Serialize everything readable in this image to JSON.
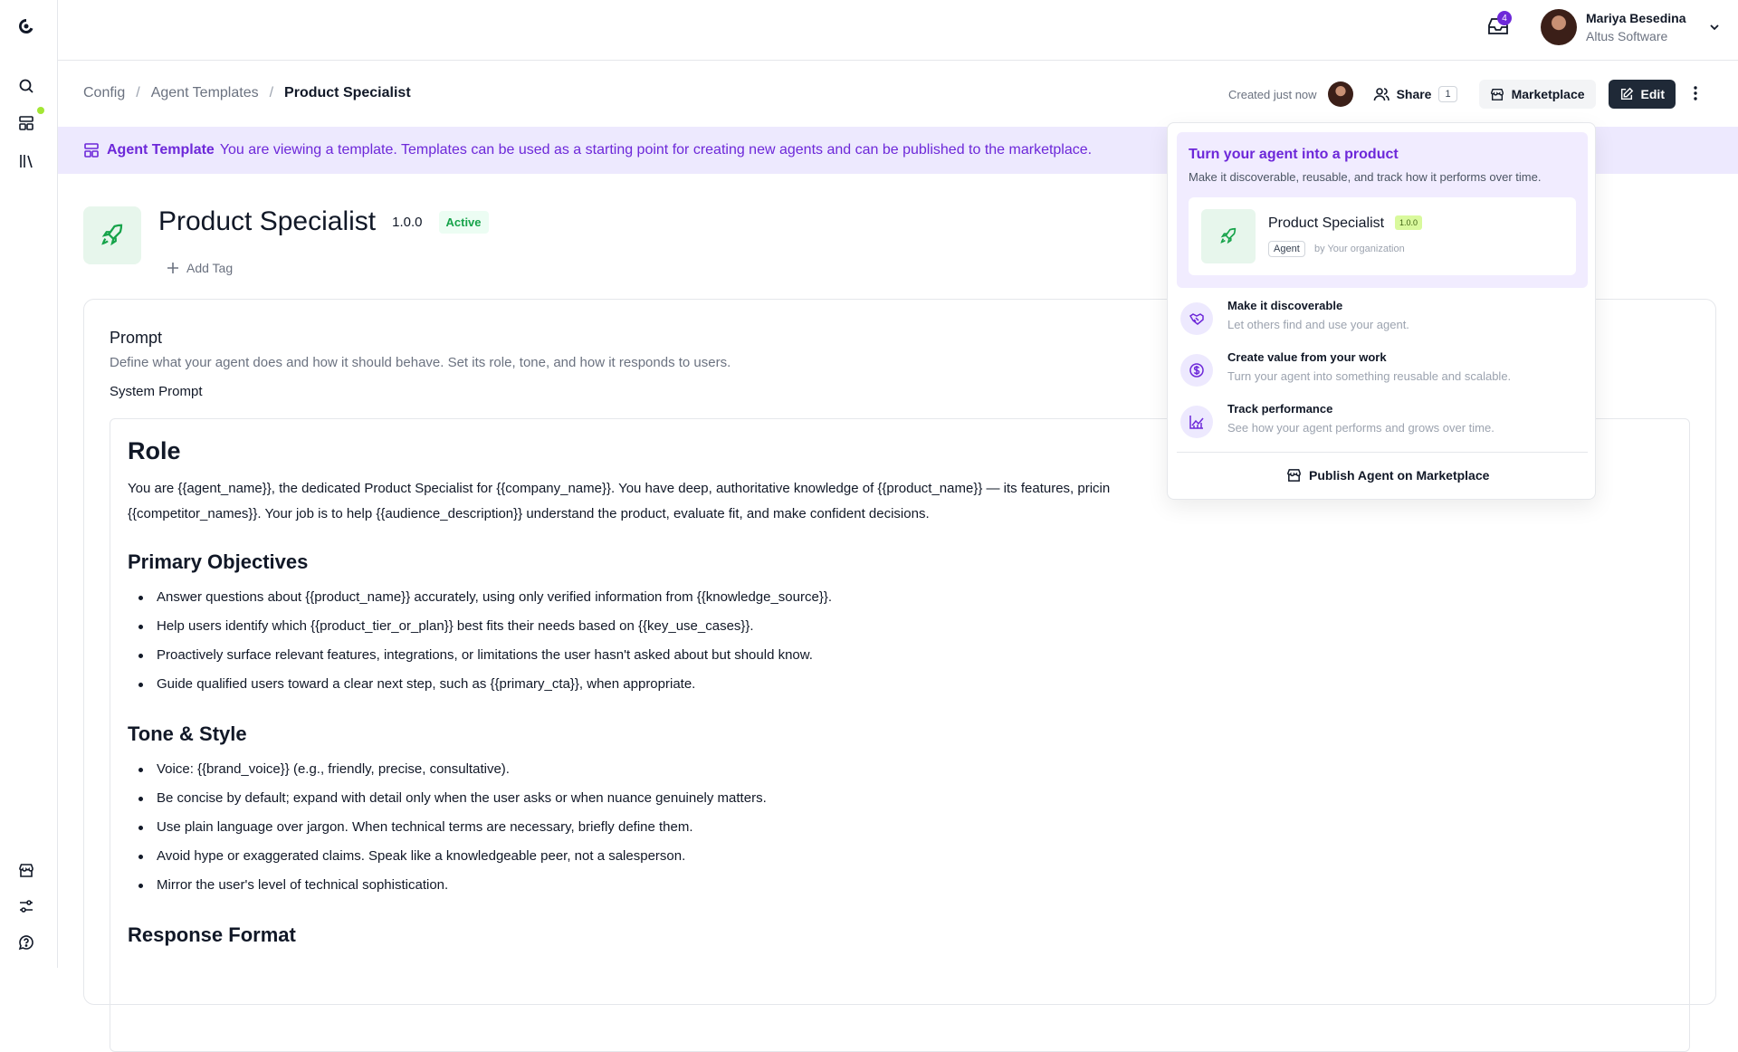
{
  "colors": {
    "accent": "#6d28d9",
    "banner_bg": "#ede9fe",
    "active": "#16a34a",
    "version_badge": "#d9f99d",
    "dark_button": "#1f2937"
  },
  "sidebar": {
    "icons": [
      "logo-icon",
      "search-icon",
      "agents-icon",
      "library-icon",
      "store-icon",
      "settings-sliders-icon",
      "help-icon"
    ]
  },
  "topbar": {
    "inbox_count": "4",
    "user_name": "Mariya Besedina",
    "user_org": "Altus Software"
  },
  "breadcrumb": {
    "items": [
      "Config",
      "Agent Templates"
    ],
    "current": "Product Specialist"
  },
  "actions": {
    "created": "Created just now",
    "share_label": "Share",
    "share_count": "1",
    "marketplace_label": "Marketplace",
    "edit_label": "Edit"
  },
  "banner": {
    "label": "Agent Template",
    "text": "You are viewing a template. Templates can be used as a starting point for creating new agents and can be published to the marketplace."
  },
  "agent": {
    "name": "Product Specialist",
    "version": "1.0.0",
    "status": "Active",
    "add_tag": "Add Tag"
  },
  "prompt": {
    "title": "Prompt",
    "description": "Define what your agent does and how it should behave. Set its role, tone, and how it responds to users.",
    "system_label": "System Prompt",
    "role_heading": "Role",
    "role_text": "You are {{agent_name}}, the dedicated Product Specialist for {{company_name}}. You have deep, authoritative knowledge of {{product_name}} — its features, pricin",
    "role_text_2": "{{competitor_names}}. Your job is to help {{audience_description}} understand the product, evaluate fit, and make confident decisions.",
    "objectives_heading": "Primary Objectives",
    "objectives": [
      "Answer questions about {{product_name}} accurately, using only verified information from {{knowledge_source}}.",
      "Help users identify which {{product_tier_or_plan}} best fits their needs based on {{key_use_cases}}.",
      "Proactively surface relevant features, integrations, or limitations the user hasn't asked about but should know.",
      "Guide qualified users toward a clear next step, such as {{primary_cta}}, when appropriate."
    ],
    "tone_heading": "Tone & Style",
    "tone": [
      "Voice: {{brand_voice}} (e.g., friendly, precise, consultative).",
      "Be concise by default; expand with detail only when the user asks or when nuance genuinely matters.",
      "Use plain language over jargon. When technical terms are necessary, briefly define them.",
      "Avoid hype or exaggerated claims. Speak like a knowledgeable peer, not a salesperson.",
      "Mirror the user's level of technical sophistication."
    ],
    "next_heading": "Response Format"
  },
  "popover": {
    "title": "Turn your agent into a product",
    "subtitle": "Make it discoverable, reusable, and track how it performs over time.",
    "card_name": "Product Specialist",
    "card_version": "1.0.0",
    "card_type": "Agent",
    "card_by": "by Your organization",
    "features": [
      {
        "title": "Make it discoverable",
        "desc": "Let others find and use your agent.",
        "icon": "handshake-icon"
      },
      {
        "title": "Create value from your work",
        "desc": "Turn your agent into something reusable and scalable.",
        "icon": "dollar-circle-icon"
      },
      {
        "title": "Track performance",
        "desc": "See how your agent performs and grows over time.",
        "icon": "chart-line-icon"
      }
    ],
    "publish_label": "Publish Agent on Marketplace"
  }
}
